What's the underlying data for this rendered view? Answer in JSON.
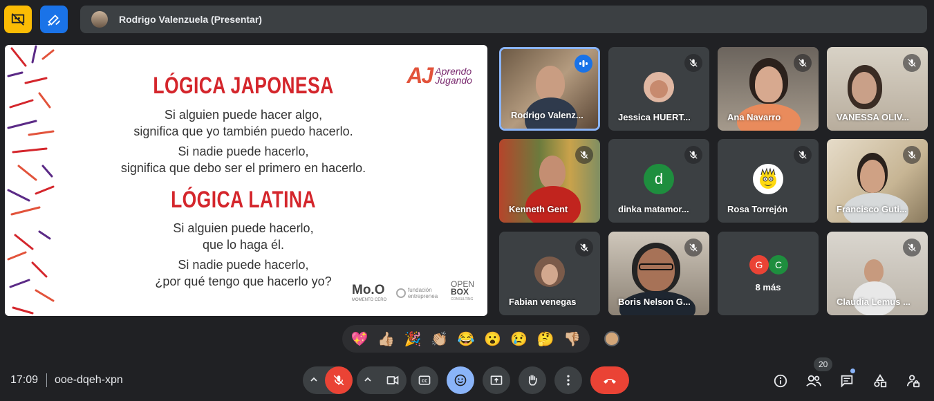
{
  "top_bar": {
    "presenter_label": "Rodrigo Valenzuela (Presentar)"
  },
  "slide": {
    "heading1": "LÓGICA JAPONESA",
    "block1": [
      "Si alguien puede hacer algo,",
      "significa que yo también puedo hacerlo."
    ],
    "block2": [
      "Si nadie puede hacerlo,",
      "significa que debo ser el primero en hacerlo."
    ],
    "heading2": "LÓGICA LATINA",
    "block3": [
      "Si alguien puede hacerlo,",
      "que lo haga él."
    ],
    "block4": [
      "Si nadie puede hacerlo,",
      "¿por qué tengo que hacerlo yo?"
    ],
    "logo_mark": "AJ",
    "logo_line1": "Aprendo",
    "logo_line2": "Jugando",
    "sponsor1": "Mo.O",
    "sponsor1_sub": "MOMENTO CERO",
    "sponsor2": "fundación",
    "sponsor2_sub": "entreprenea",
    "sponsor3": "OPEN",
    "sponsor3_sub": "BOX",
    "sponsor3_small": "CONSULTING"
  },
  "participants": [
    {
      "name": "Rodrigo Valenz...",
      "state": "speaking"
    },
    {
      "name": "Jessica HUERT...",
      "state": "muted"
    },
    {
      "name": "Ana Navarro",
      "state": "muted"
    },
    {
      "name": "VANESSA OLIV...",
      "state": "muted"
    },
    {
      "name": "Kenneth Gent",
      "state": "muted"
    },
    {
      "name": "dinka matamor...",
      "state": "muted",
      "initial": "d"
    },
    {
      "name": "Rosa Torrejón",
      "state": "muted"
    },
    {
      "name": "Francisco Guti...",
      "state": "muted"
    },
    {
      "name": "Fabian venegas",
      "state": "muted"
    },
    {
      "name": "Boris Nelson G...",
      "state": "muted"
    },
    {
      "name": "8 más",
      "state": "group",
      "initials": [
        "G",
        "C"
      ]
    },
    {
      "name": "Claudia Lemus ...",
      "state": "muted"
    }
  ],
  "reactions": [
    "💖",
    "👍🏼",
    "🎉",
    "👏🏼",
    "😂",
    "😮",
    "😢",
    "🤔",
    "👎🏼"
  ],
  "bottom_bar": {
    "time": "17:09",
    "meeting_code": "ooe-dqeh-xpn",
    "participant_count": "20"
  },
  "colors": {
    "background": "#202124",
    "tile": "#3c4043",
    "accent_blue": "#8ab4f8",
    "red": "#ea4335",
    "slide_red": "#d4262c"
  }
}
